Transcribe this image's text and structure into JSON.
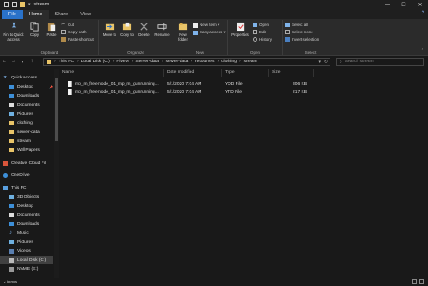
{
  "window": {
    "title": "stream",
    "controls": {
      "minimize": "—",
      "maximize": "☐",
      "close": "✕"
    }
  },
  "tabs": {
    "file": "File",
    "home": "Home",
    "share": "Share",
    "view": "View",
    "help": "?"
  },
  "ribbon": {
    "clipboard": {
      "label": "Clipboard",
      "pin": "Pin to Quick access",
      "copy": "Copy",
      "paste": "Paste",
      "cut": "Cut",
      "copy_path": "Copy path",
      "paste_shortcut": "Paste shortcut"
    },
    "organize": {
      "label": "Organize",
      "move_to": "Move to",
      "copy_to": "Copy to",
      "delete": "Delete",
      "rename": "Rename"
    },
    "new": {
      "label": "New",
      "new_folder": "New folder",
      "new_item": "New item ▾",
      "easy_access": "Easy access ▾"
    },
    "open": {
      "label": "Open",
      "properties": "Properties",
      "open": "Open",
      "edit": "Edit",
      "history": "History"
    },
    "select": {
      "label": "Select",
      "select_all": "Select all",
      "select_none": "Select none",
      "invert": "Invert selection"
    }
  },
  "address": {
    "crumbs": [
      "This PC",
      "Local Disk (C:)",
      "FiveM",
      "Server-data",
      "server-data",
      "resources",
      "clothing",
      "stream"
    ],
    "search_placeholder": "Search stream"
  },
  "nav": {
    "quick_access": "Quick access",
    "items": [
      "Desktop",
      "Downloads",
      "Documents",
      "Pictures",
      "clothing",
      "server-data",
      "stream",
      "WallPapers"
    ],
    "creative_cloud": "Creative Cloud Fil",
    "onedrive": "OneDrive",
    "this_pc": "This PC",
    "pc_items": [
      "3D Objects",
      "Desktop",
      "Documents",
      "Downloads",
      "Music",
      "Pictures",
      "Videos",
      "Local Disk (C:)",
      "NVME (E:)"
    ]
  },
  "columns": {
    "name": "Name",
    "date": "Date modified",
    "type": "Type",
    "size": "Size"
  },
  "files": [
    {
      "name": "mp_m_freemode_01_mp_m_gunrunning...",
      "date": "5/1/2020 7:04 AM",
      "type": "YDD File",
      "size": "306 KB"
    },
    {
      "name": "mp_m_freemode_01_mp_m_gunrunning...",
      "date": "5/1/2020 7:04 AM",
      "type": "YTD File",
      "size": "217 KB"
    }
  ],
  "status": {
    "count": "2 items"
  },
  "colors": {
    "accent": "#2a72c9",
    "folder": "#e9c468",
    "background": "#191919"
  }
}
